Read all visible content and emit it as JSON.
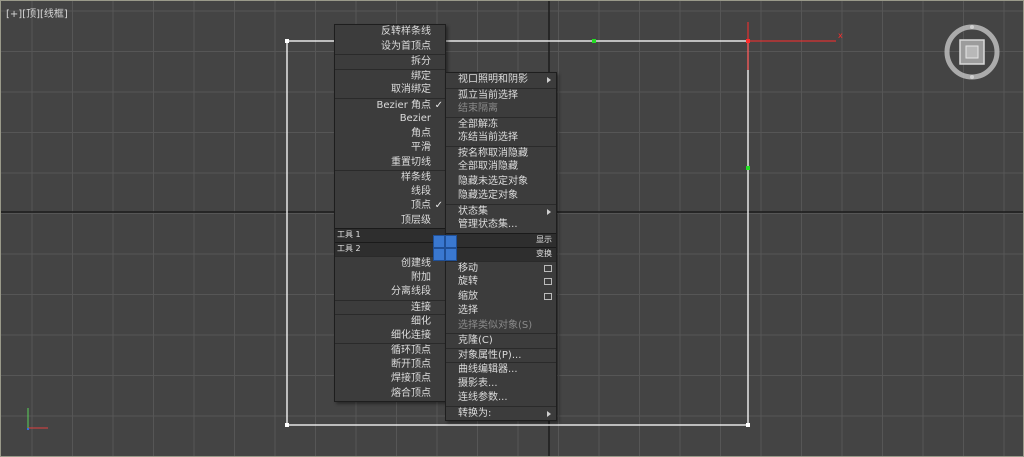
{
  "viewport": {
    "label_plus": "[+]",
    "label_view": "[顶]",
    "label_shading": "[线框]"
  },
  "menu_left": {
    "items": [
      {
        "label": "反转样条线",
        "disabled": false
      },
      {
        "label": "设为首顶点",
        "disabled": false
      },
      {
        "label": "拆分",
        "disabled": false,
        "sep": true
      },
      {
        "label": "绑定",
        "disabled": false,
        "sep": true
      },
      {
        "label": "取消绑定",
        "disabled": false
      },
      {
        "label": "Bezier 角点",
        "disabled": false,
        "sep": true,
        "checked": true
      },
      {
        "label": "Bezier",
        "disabled": false
      },
      {
        "label": "角点",
        "disabled": false
      },
      {
        "label": "平滑",
        "disabled": false
      },
      {
        "label": "重置切线",
        "disabled": false
      },
      {
        "label": "样条线",
        "disabled": false,
        "sep": true
      },
      {
        "label": "线段",
        "disabled": false
      },
      {
        "label": "顶点",
        "disabled": false,
        "checked": true
      },
      {
        "label": "顶层级",
        "disabled": false
      }
    ],
    "items2": [
      {
        "label": "创建线",
        "sep": true
      },
      {
        "label": "附加"
      },
      {
        "label": "分离线段"
      },
      {
        "label": "连接",
        "sep": true
      },
      {
        "label": "细化",
        "sep": true
      },
      {
        "label": "细化连接"
      },
      {
        "label": "循环顶点",
        "sep": true
      },
      {
        "label": "断开顶点"
      },
      {
        "label": "焊接顶点"
      },
      {
        "label": "熔合顶点"
      }
    ]
  },
  "menu_right": {
    "items": [
      {
        "label": "视口照明和阴影",
        "submenu": true
      },
      {
        "label": "孤立当前选择",
        "sep": true
      },
      {
        "label": "结束隔离",
        "disabled": true
      },
      {
        "label": "全部解冻",
        "sep": true
      },
      {
        "label": "冻结当前选择"
      },
      {
        "label": "按名称取消隐藏",
        "sep": true
      },
      {
        "label": "全部取消隐藏"
      },
      {
        "label": "隐藏未选定对象"
      },
      {
        "label": "隐藏选定对象"
      },
      {
        "label": "状态集",
        "sep": true,
        "submenu": true
      },
      {
        "label": "管理状态集..."
      }
    ],
    "items2": [
      {
        "label": "移动",
        "sep": true,
        "box": true
      },
      {
        "label": "旋转",
        "box": true
      },
      {
        "label": "缩放",
        "box": true
      },
      {
        "label": "选择"
      },
      {
        "label": "选择类似对象(S)",
        "disabled": true
      },
      {
        "label": "克隆(C)",
        "sep": true
      },
      {
        "label": "对象属性(P)...",
        "sep": true
      },
      {
        "label": "曲线编辑器...",
        "sep": true
      },
      {
        "label": "摄影表..."
      },
      {
        "label": "连线参数..."
      },
      {
        "label": "转换为:",
        "sep": true,
        "submenu": true
      }
    ]
  },
  "toolbars": {
    "tool1_label": "工具 1",
    "tool1_right": "显示",
    "tool2_label": "工具 2",
    "tool2_right": "变换"
  },
  "colors": {
    "grid_bg": "#444444",
    "grid_line": "#565656",
    "axis_line": "#1c1c1c",
    "spline": "#ffffff",
    "vertex_selected": "#ff2b2b",
    "vertex_green": "#22dd22",
    "highlight_blue": "#3a78d0"
  }
}
